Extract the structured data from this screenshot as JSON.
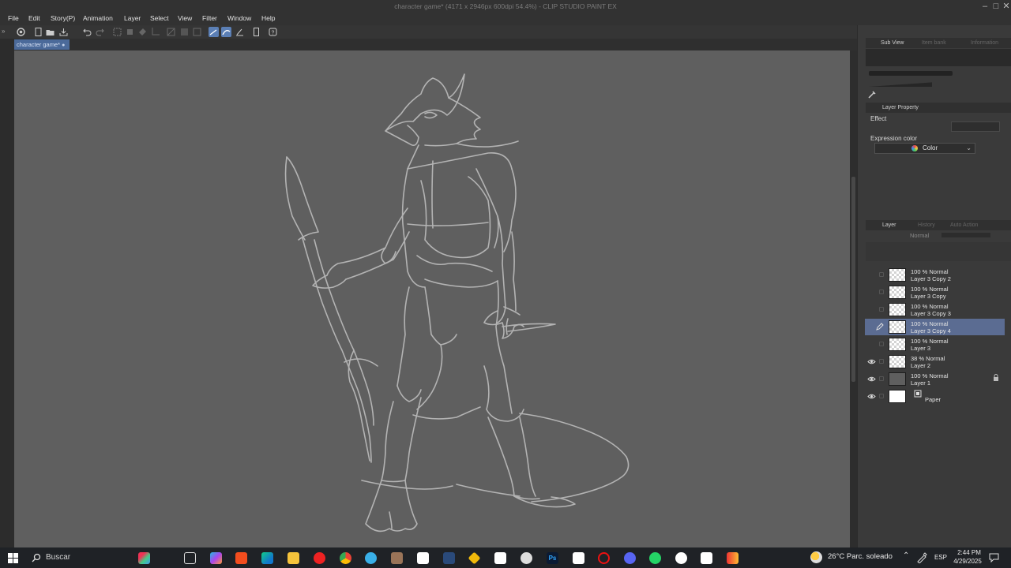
{
  "window": {
    "title": "character game* (4171 x 2946px 600dpi 54.4%)  - CLIP STUDIO PAINT EX"
  },
  "menu": [
    "File",
    "Edit",
    "Story(P)",
    "Animation",
    "Layer",
    "Select",
    "View",
    "Filter",
    "Window",
    "Help"
  ],
  "document_tab": "character game*",
  "side_panels": {
    "subview_tabs": [
      "Sub View",
      "Item bank",
      "Information"
    ],
    "property_tabs": [
      "Layer Property"
    ],
    "effect_label": "Effect",
    "expression_color_label": "Expression color",
    "expression_color_value": "Color",
    "layer_tabs": [
      "Layer",
      "History",
      "Auto Action"
    ],
    "blend_mode": "Normal"
  },
  "layers": [
    {
      "mode": "100 % Normal",
      "name": "Layer 3 Copy 2",
      "visible": false,
      "selected": false,
      "locked": false
    },
    {
      "mode": "100 % Normal",
      "name": "Layer 3 Copy",
      "visible": false,
      "selected": false,
      "locked": false
    },
    {
      "mode": "100 % Normal",
      "name": "Layer 3 Copy 3",
      "visible": false,
      "selected": false,
      "locked": false
    },
    {
      "mode": "100 % Normal",
      "name": "Layer 3 Copy 4",
      "visible": false,
      "selected": true,
      "locked": false
    },
    {
      "mode": "100 % Normal",
      "name": "Layer 3",
      "visible": false,
      "selected": false,
      "locked": false
    },
    {
      "mode": "38 % Normal",
      "name": "Layer 2",
      "visible": true,
      "selected": false,
      "locked": false
    },
    {
      "mode": "100 % Normal",
      "name": "Layer 1",
      "visible": true,
      "selected": false,
      "locked": true
    },
    {
      "mode": "",
      "name": "Paper",
      "visible": true,
      "selected": false,
      "locked": false
    }
  ],
  "taskbar": {
    "search_placeholder": "Buscar",
    "weather": "26°C  Parc. soleado",
    "language": "ESP",
    "time": "2:44 PM",
    "date": "4/29/2025"
  },
  "colors": {
    "accent": "#5b7fb5",
    "canvas": "#5f5f5f",
    "sketch_line": "#b3b3b3",
    "selected_layer": "#5b6c92"
  }
}
